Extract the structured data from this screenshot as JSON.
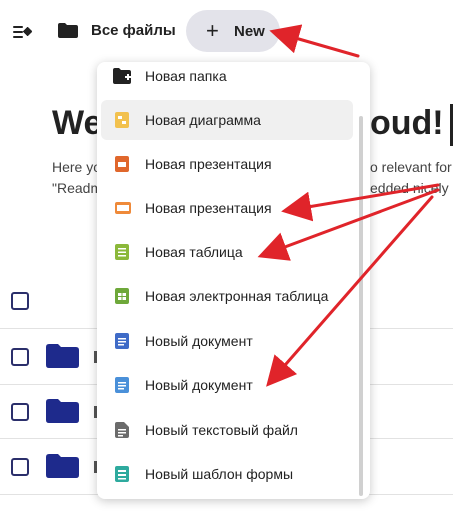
{
  "header": {
    "breadcrumb": "Все файлы",
    "new_button": "New",
    "new_plus": "+"
  },
  "background": {
    "welcome_left": "We",
    "welcome_right": "oud!",
    "desc_left_1": "Here yo",
    "desc_left_2": "\"Readm",
    "desc_right_1": "o relevant for",
    "desc_right_2": "edded nicely"
  },
  "menu": {
    "items": [
      {
        "label": "Новая папка",
        "icon": "folder-plus-icon",
        "color": "#222222"
      },
      {
        "label": "Новая диаграмма",
        "icon": "diagram-icon",
        "color": "#f2c14e"
      },
      {
        "label": "Новая презентация",
        "icon": "presentation-icon",
        "color": "#e0672c"
      },
      {
        "label": "Новая презентация",
        "icon": "presentation-icon",
        "color": "#ef8a3a"
      },
      {
        "label": "Новая таблица",
        "icon": "spreadsheet-icon",
        "color": "#8bb83a"
      },
      {
        "label": "Новая электронная таблица",
        "icon": "spreadsheet-icon",
        "color": "#6ea83a"
      },
      {
        "label": "Новый документ",
        "icon": "document-icon",
        "color": "#3f6bc7"
      },
      {
        "label": "Новый документ",
        "icon": "document-icon",
        "color": "#4a90d9"
      },
      {
        "label": "Новый текстовый файл",
        "icon": "text-file-icon",
        "color": "#6b6b6b"
      },
      {
        "label": "Новый шаблон формы",
        "icon": "form-template-icon",
        "color": "#2eaa9e"
      }
    ]
  },
  "colors": {
    "accent_folder": "#1e2a8c",
    "annotation_arrow": "#e0242a",
    "new_button_bg": "#e3e3ea"
  }
}
